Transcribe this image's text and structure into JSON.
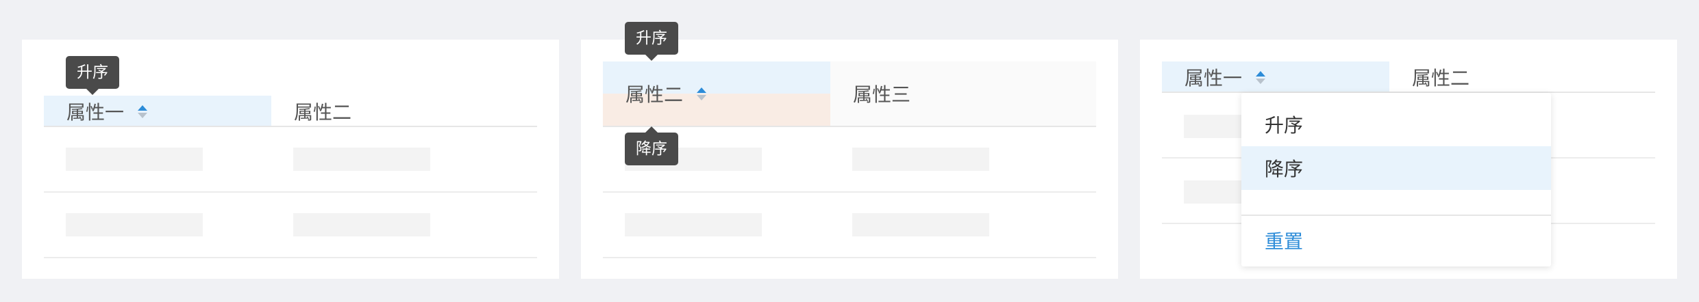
{
  "panel1": {
    "tooltip": "升序",
    "headers": [
      "属性一",
      "属性二"
    ]
  },
  "panel2": {
    "tooltip_top": "升序",
    "tooltip_bottom": "降序",
    "headers": [
      "属性二",
      "属性三"
    ]
  },
  "panel3": {
    "headers": [
      "属性一",
      "属性二"
    ],
    "dropdown": {
      "options": [
        "升序",
        "降序"
      ],
      "selected": "降序",
      "reset": "重置"
    }
  },
  "colors": {
    "background": "#f0f1f4",
    "accent": "#2d8cd8",
    "active_header": "#e8f3fc",
    "tooltip": "#4a4a4a"
  }
}
